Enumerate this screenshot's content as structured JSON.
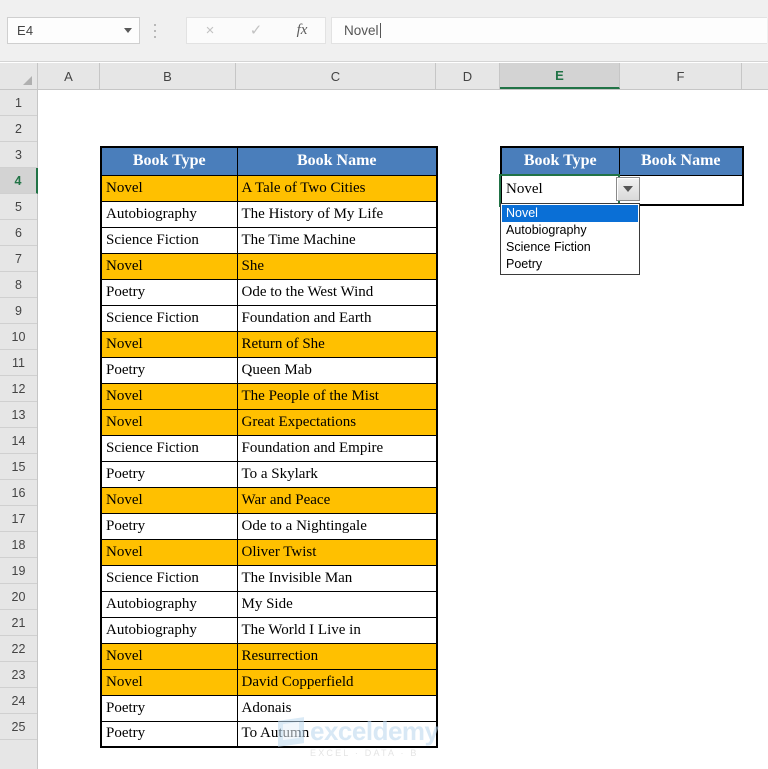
{
  "app": {
    "name_box_value": "E4",
    "formula_value": "Novel",
    "cancel_icon": "×",
    "confirm_icon": "✓",
    "fx_label": "fx"
  },
  "grid": {
    "column_headers": [
      "A",
      "B",
      "C",
      "D",
      "E",
      "F"
    ],
    "selected_column": "E",
    "row_headers": [
      "1",
      "2",
      "3",
      "4",
      "5",
      "6",
      "7",
      "8",
      "9",
      "10",
      "11",
      "12",
      "13",
      "14",
      "15",
      "16",
      "17",
      "18",
      "19",
      "20",
      "21",
      "22",
      "23",
      "24",
      "25"
    ],
    "selected_row": "4"
  },
  "colors": {
    "header_blue": "#4a7ebb",
    "highlight_orange": "#ffc000",
    "selection_green": "#217346",
    "dropdown_selected_blue": "#0a6fd6"
  },
  "data_table": {
    "headers": [
      "Book Type",
      "Book Name"
    ],
    "rows": [
      {
        "type": "Novel",
        "name": "A Tale of Two Cities",
        "highlighted": true
      },
      {
        "type": "Autobiography",
        "name": "The History of My Life",
        "highlighted": false
      },
      {
        "type": "Science Fiction",
        "name": "The Time Machine",
        "highlighted": false
      },
      {
        "type": "Novel",
        "name": "She",
        "highlighted": true
      },
      {
        "type": "Poetry",
        "name": "Ode to the West Wind",
        "highlighted": false
      },
      {
        "type": "Science Fiction",
        "name": "Foundation and Earth",
        "highlighted": false
      },
      {
        "type": "Novel",
        "name": "Return of She",
        "highlighted": true
      },
      {
        "type": "Poetry",
        "name": "Queen Mab",
        "highlighted": false
      },
      {
        "type": "Novel",
        "name": "The People of the Mist",
        "highlighted": true
      },
      {
        "type": "Novel",
        "name": "Great Expectations",
        "highlighted": true
      },
      {
        "type": "Science Fiction",
        "name": "Foundation and Empire",
        "highlighted": false
      },
      {
        "type": "Poetry",
        "name": "To a Skylark",
        "highlighted": false
      },
      {
        "type": "Novel",
        "name": "War and Peace",
        "highlighted": true
      },
      {
        "type": "Poetry",
        "name": "Ode to a Nightingale",
        "highlighted": false
      },
      {
        "type": "Novel",
        "name": "Oliver Twist",
        "highlighted": true
      },
      {
        "type": "Science Fiction",
        "name": "The Invisible Man",
        "highlighted": false
      },
      {
        "type": "Autobiography",
        "name": "My Side",
        "highlighted": false
      },
      {
        "type": "Autobiography",
        "name": "The World I Live in",
        "highlighted": false
      },
      {
        "type": "Novel",
        "name": "Resurrection",
        "highlighted": true
      },
      {
        "type": "Novel",
        "name": "David Copperfield",
        "highlighted": true
      },
      {
        "type": "Poetry",
        "name": "Adonais",
        "highlighted": false
      },
      {
        "type": "Poetry",
        "name": "To Autumn",
        "highlighted": false
      }
    ]
  },
  "mini_table": {
    "headers": [
      "Book Type",
      "Book Name"
    ],
    "selected_value": "Novel",
    "book_name_value": ""
  },
  "dropdown": {
    "open": true,
    "options": [
      "Novel",
      "Autobiography",
      "Science Fiction",
      "Poetry"
    ],
    "selected_index": 0,
    "arrow_icon": "chevron-down"
  },
  "watermark": {
    "name": "exceldemy",
    "tagline": "EXCEL · DATA · B"
  }
}
